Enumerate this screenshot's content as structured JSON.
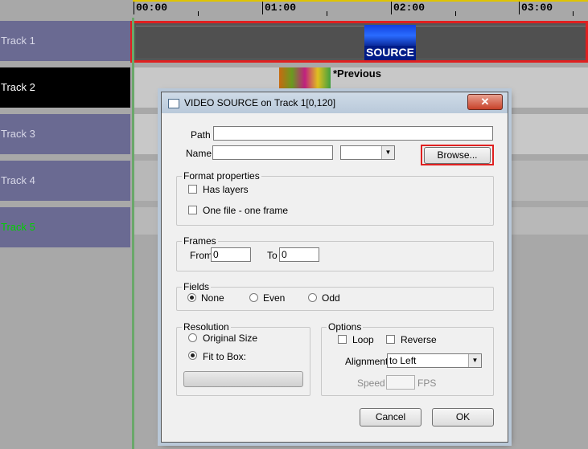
{
  "ruler": {
    "ticks": [
      "00:00",
      "01:00",
      "02:00",
      "03:00"
    ]
  },
  "tracks": [
    {
      "label": "Track 1"
    },
    {
      "label": "Track 2"
    },
    {
      "label": "Track 3"
    },
    {
      "label": "Track 4"
    },
    {
      "label": "Track 5"
    }
  ],
  "clips": {
    "track1": {
      "label": "SOURCE",
      "color": "#1a3fd8"
    },
    "track2": {
      "label": "*Previous"
    }
  },
  "colors": {
    "track_label_bg": "#6a6a92",
    "highlight": "#e02020",
    "track5_label": "#00d000"
  },
  "dialog": {
    "title": "VIDEO SOURCE  on  Track 1[0,120]",
    "close_label": "✕",
    "path_label": "Path",
    "path_value": "",
    "name_label": "Name",
    "name_value": "",
    "name_select_value": "",
    "browse_label": "Browse...",
    "format_title": "Format properties",
    "has_layers_label": "Has layers",
    "one_file_label": "One file - one frame",
    "frames_title": "Frames",
    "from_label": "From",
    "from_value": "0",
    "to_label": "To",
    "to_value": "0",
    "fields_title": "Fields",
    "fields_options": [
      "None",
      "Even",
      "Odd"
    ],
    "fields_selected": "None",
    "resolution_title": "Resolution",
    "original_size_label": "Original Size",
    "fit_to_box_label": "Fit to Box:",
    "resolution_selected": "Fit to Box:",
    "options_title": "Options",
    "loop_label": "Loop",
    "reverse_label": "Reverse",
    "alignment_label": "Alignment",
    "alignment_value": "to Left",
    "speed_label": "Speed",
    "speed_value": "",
    "fps_label": "FPS",
    "cancel_label": "Cancel",
    "ok_label": "OK"
  }
}
